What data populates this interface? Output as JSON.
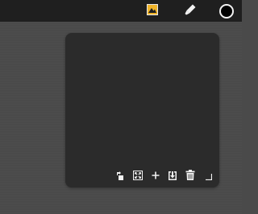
{
  "topbar": {
    "tools": [
      {
        "name": "image",
        "icon": "image-icon",
        "accent": "#f0b429"
      },
      {
        "name": "brush",
        "icon": "brush-icon"
      },
      {
        "name": "color",
        "icon": "color-swatch",
        "color": "#000000"
      }
    ]
  },
  "panel": {
    "toolbar": [
      {
        "icon": "rotate-icon"
      },
      {
        "icon": "expand-icon"
      },
      {
        "icon": "add-icon"
      },
      {
        "icon": "import-icon"
      },
      {
        "icon": "delete-icon"
      },
      {
        "icon": "resize-handle-icon"
      }
    ]
  },
  "colors": {
    "topbar": "#1f1f1f",
    "workspace": "#4a4a4a",
    "panel": "#2b2b2b",
    "icon": "#f2f2f2"
  }
}
